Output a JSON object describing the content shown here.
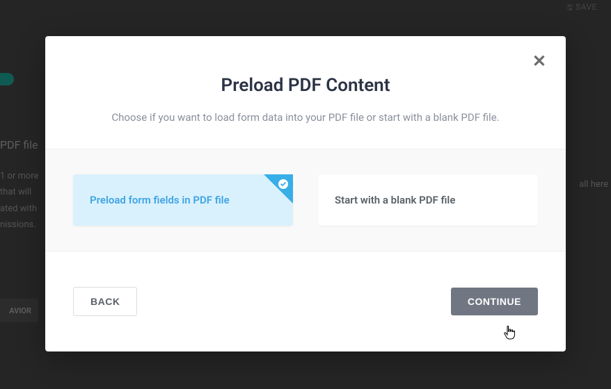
{
  "background": {
    "save_label": "SAVE",
    "heading_fragment": "PDF file",
    "line1": "1 or more",
    "line2": "that will",
    "line3": "ated with",
    "line4": "nissions.",
    "right_fragment": "all here",
    "bottom_button_fragment": "AVIOR"
  },
  "modal": {
    "title": "Preload PDF Content",
    "subtitle": "Choose if you want to load form data into your PDF file or start with a blank PDF file.",
    "options": [
      {
        "label": "Preload form fields in PDF file",
        "selected": true
      },
      {
        "label": "Start with a blank PDF file",
        "selected": false
      }
    ],
    "back_label": "BACK",
    "continue_label": "CONTINUE"
  }
}
